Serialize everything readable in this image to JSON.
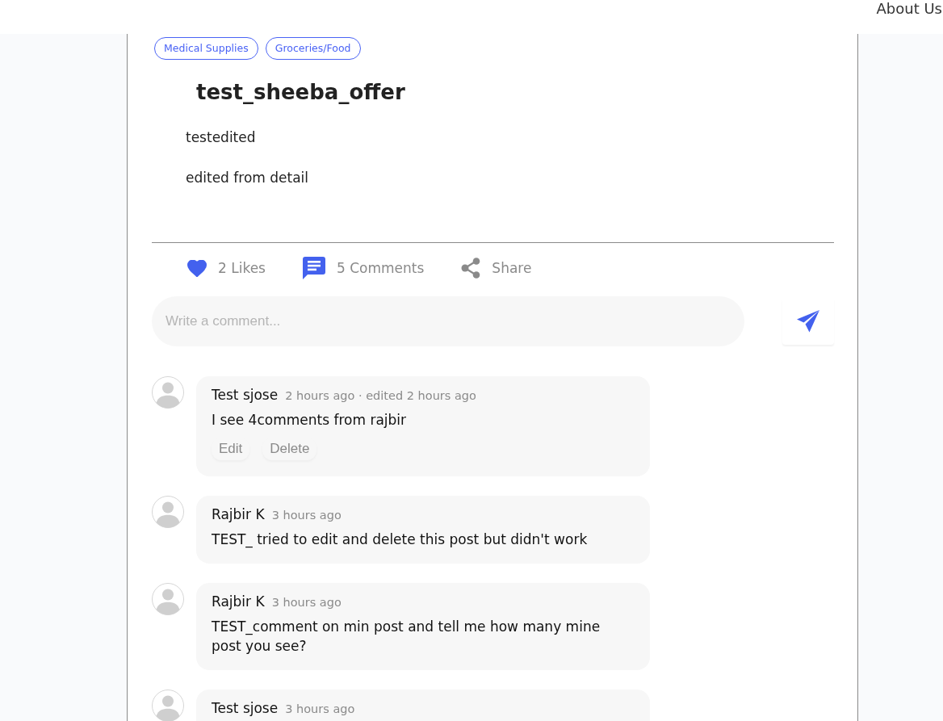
{
  "header": {
    "link": "About Us"
  },
  "post": {
    "tags": [
      "Medical Supplies",
      "Groceries/Food"
    ],
    "title": "test_sheeba_offer",
    "paragraphs": [
      "testedited",
      "edited from detail"
    ],
    "liked": true,
    "actions": [
      {
        "kind": "like",
        "label": "2 Likes"
      },
      {
        "kind": "comment",
        "label": "5 Comments"
      },
      {
        "kind": "share",
        "label": "Share"
      }
    ]
  },
  "comment_box": {
    "placeholder": "Write a comment..."
  },
  "comments": [
    {
      "author": "Test sjose",
      "time": "2 hours ago · edited 2 hours ago",
      "text": "I see 4comments from rajbir",
      "buttons": [
        "Edit",
        "Delete"
      ]
    },
    {
      "author": "Rajbir K",
      "time": "3 hours ago",
      "text": "TEST_ tried to edit and delete this post but didn't work"
    },
    {
      "author": "Rajbir K",
      "time": "3 hours ago",
      "text": "TEST_comment on min post and tell me how many mine post you see?"
    },
    {
      "author": "Test sjose",
      "time": "3 hours ago"
    }
  ]
}
